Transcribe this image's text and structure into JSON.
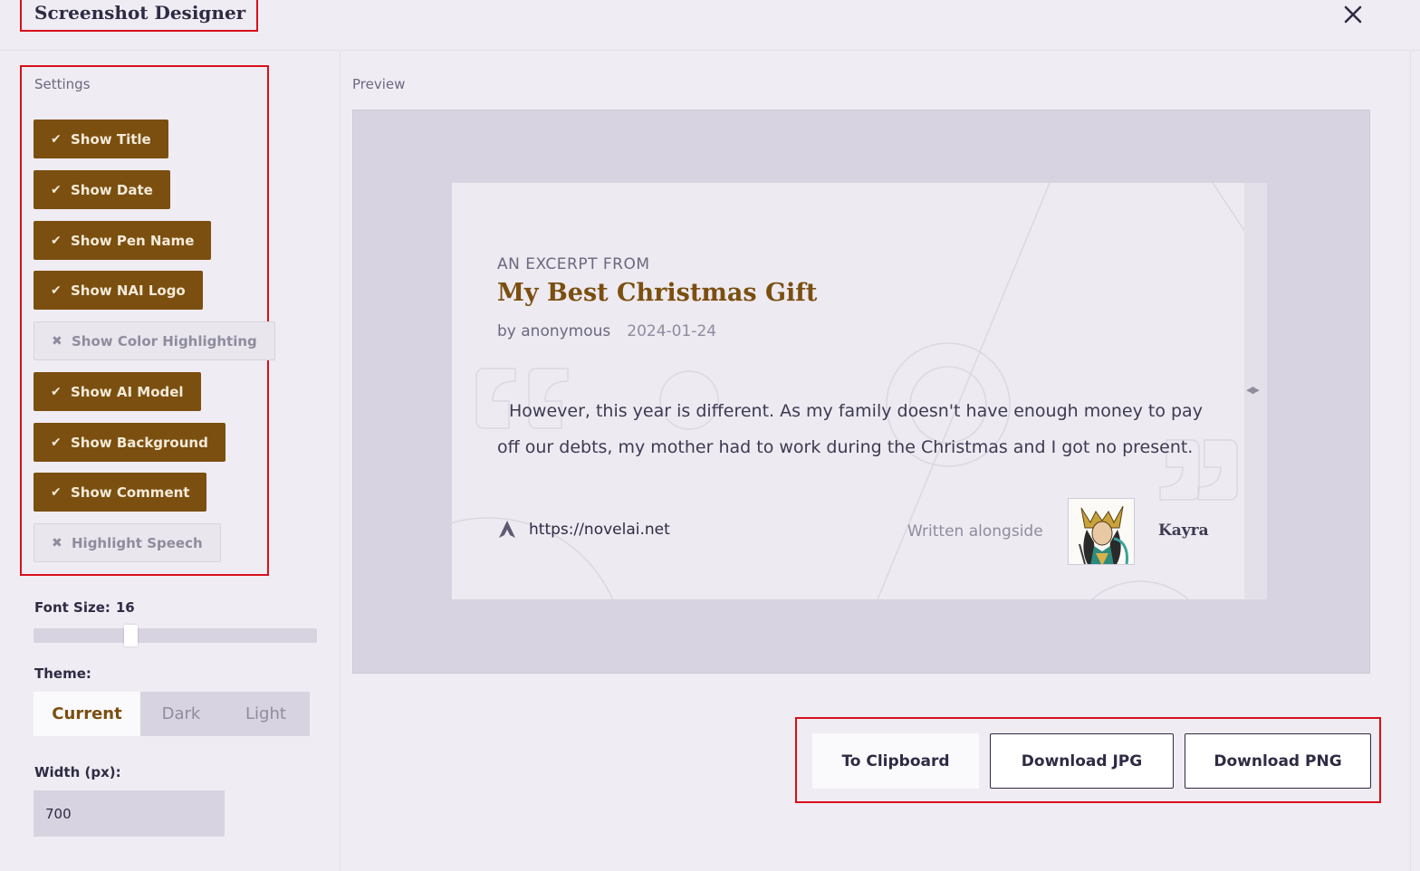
{
  "window": {
    "title": "Screenshot Designer",
    "close_icon": "close-icon"
  },
  "settings": {
    "label": "Settings",
    "toggles": [
      {
        "label": "Show Title",
        "enabled": true
      },
      {
        "label": "Show Date",
        "enabled": true
      },
      {
        "label": "Show Pen Name",
        "enabled": true
      },
      {
        "label": "Show NAI Logo",
        "enabled": true
      },
      {
        "label": "Show Color Highlighting",
        "enabled": false
      },
      {
        "label": "Show AI Model",
        "enabled": true
      },
      {
        "label": "Show Background",
        "enabled": true
      },
      {
        "label": "Show Comment",
        "enabled": true
      },
      {
        "label": "Highlight Speech",
        "enabled": false
      }
    ],
    "check_glyph": "✔",
    "cross_glyph": "✖",
    "font_size_label": "Font Size:",
    "font_size_value": "16",
    "font_size_fraction": 0.33,
    "theme_label": "Theme:",
    "themes": [
      "Current",
      "Dark",
      "Light"
    ],
    "theme_selected": "Current",
    "width_label": "Width (px):",
    "width_value": "700"
  },
  "preview": {
    "label": "Preview",
    "card": {
      "excerpt_from": "AN EXCERPT FROM",
      "title": "My Best Christmas Gift",
      "pen_name": "by anonymous",
      "date": "2024-01-24",
      "excerpt": "However, this year is different. As my family doesn't have enough money to pay off our debts, my mother had to work during the Christmas and I got no present.",
      "url": "https://novelai.net",
      "written_alongside": "Written alongside",
      "model_name": "Kayra"
    }
  },
  "actions": {
    "clipboard": "To Clipboard",
    "download_jpg": "Download JPG",
    "download_png": "Download PNG"
  },
  "colors": {
    "accent": "#7b4f10",
    "highlight_border": "#d8101a",
    "background": "#f0ecf3"
  }
}
